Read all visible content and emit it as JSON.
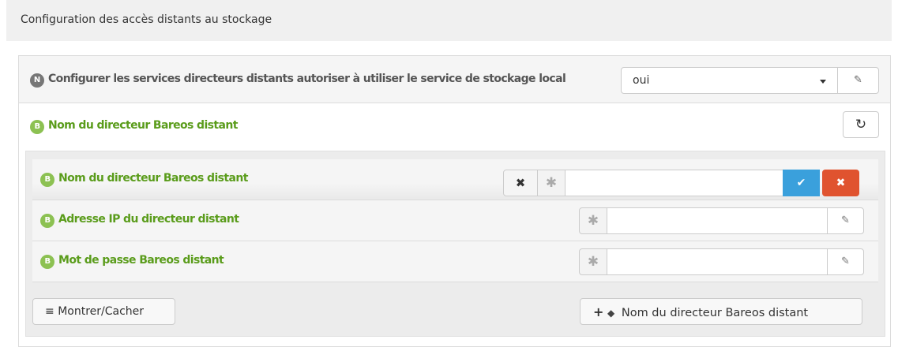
{
  "section": {
    "title": "Configuration des accès distants au stockage"
  },
  "top_row": {
    "badge": "N",
    "label": "Configurer les services directeurs distants autoriser à utiliser le service de stockage local",
    "select_value": "oui",
    "edit_icon": "✎"
  },
  "group": {
    "badge": "B",
    "label": "Nom du directeur Bareos distant",
    "reset_icon": "↻"
  },
  "inner_rows": [
    {
      "badge": "B",
      "label": "Nom du directeur Bareos distant",
      "value": "",
      "clear_icon": "✖",
      "star": "✱",
      "confirm_icon": "✔",
      "remove_icon": "✖"
    },
    {
      "badge": "B",
      "label": "Adresse IP du directeur distant",
      "value": "",
      "star": "✱",
      "edit_icon": "✎"
    },
    {
      "badge": "B",
      "label": "Mot de passe Bareos distant",
      "value": "",
      "star": "✱",
      "edit_icon": "✎"
    }
  ],
  "buttons": {
    "show_hide_icon": "≡",
    "show_hide": "Montrer/Cacher",
    "add_icon": "+",
    "tag_icon": "◆",
    "add_label": "Nom du directeur Bareos distant"
  },
  "colors": {
    "green": "#5a9c1b",
    "blue": "#3aa0dc",
    "red": "#e0532f"
  }
}
